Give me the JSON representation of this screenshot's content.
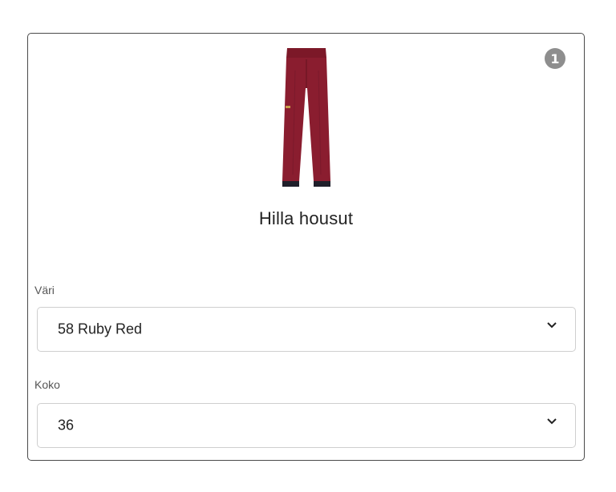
{
  "product": {
    "name": "Hilla housut",
    "image_icon": "pants-icon",
    "badge": "1"
  },
  "color_field": {
    "label": "Väri",
    "value": "58 Ruby Red",
    "icon": "chevron-down-icon"
  },
  "size_field": {
    "label": "Koko",
    "value": "36",
    "icon": "chevron-down-icon"
  },
  "colors": {
    "pants": "#8a1d2f",
    "badge": "#8e8e8e",
    "border": "#4a4a4a"
  }
}
